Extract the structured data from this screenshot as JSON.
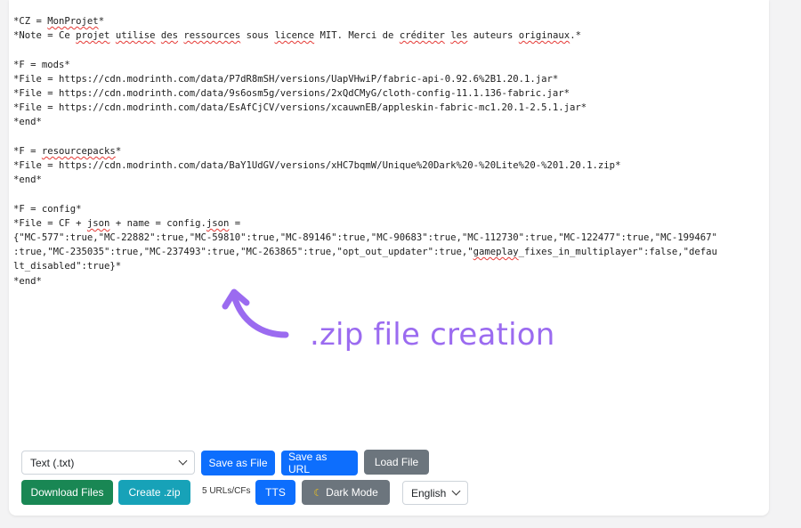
{
  "editor": {
    "lines": [
      [
        {
          "t": "*CZ = "
        },
        {
          "t": "MonProjet",
          "sq": true
        },
        {
          "t": "*"
        }
      ],
      [
        {
          "t": "*Note = Ce "
        },
        {
          "t": "projet",
          "sq": true
        },
        {
          "t": " "
        },
        {
          "t": "utilise",
          "sq": true
        },
        {
          "t": " "
        },
        {
          "t": "des",
          "sq": true
        },
        {
          "t": " "
        },
        {
          "t": "ressources",
          "sq": true
        },
        {
          "t": " sous "
        },
        {
          "t": "licence",
          "sq": true
        },
        {
          "t": " MIT. Merci de "
        },
        {
          "t": "créditer",
          "sq": true
        },
        {
          "t": " "
        },
        {
          "t": "les",
          "sq": true
        },
        {
          "t": " auteurs "
        },
        {
          "t": "originaux",
          "sq": true
        },
        {
          "t": ".*"
        }
      ],
      [],
      [
        {
          "t": "*F = mods*"
        }
      ],
      [
        {
          "t": "*File = https://cdn.modrinth.com/data/P7dR8mSH/versions/UapVHwiP/fabric-api-0.92.6%2B1.20.1.jar*"
        }
      ],
      [
        {
          "t": "*File = https://cdn.modrinth.com/data/9s6osm5g/versions/2xQdCMyG/cloth-config-11.1.136-fabric.jar*"
        }
      ],
      [
        {
          "t": "*File = https://cdn.modrinth.com/data/EsAfCjCV/versions/xcauwnEB/appleskin-fabric-mc1.20.1-2.5.1.jar*"
        }
      ],
      [
        {
          "t": "*end*"
        }
      ],
      [],
      [
        {
          "t": "*F = "
        },
        {
          "t": "resourcepacks",
          "sq": true
        },
        {
          "t": "*"
        }
      ],
      [
        {
          "t": "*File = https://cdn.modrinth.com/data/BaY1UdGV/versions/xHC7bqmW/Unique%20Dark%20-%20Lite%20-%201.20.1.zip*"
        }
      ],
      [
        {
          "t": "*end*"
        }
      ],
      [],
      [
        {
          "t": "*F = config*"
        }
      ],
      [
        {
          "t": "*File = CF + "
        },
        {
          "t": "json",
          "sq": true
        },
        {
          "t": " + name = config."
        },
        {
          "t": "json",
          "sq": true
        },
        {
          "t": " ="
        }
      ],
      [
        {
          "t": "{\"MC-577\":true,\"MC-22882\":true,\"MC-59810\":true,\"MC-89146\":true,\"MC-90683\":true,\"MC-112730\":true,\"MC-122477\":true,\"MC-199467\""
        }
      ],
      [
        {
          "t": ":true,\"MC-235035\":true,\"MC-237493\":true,\"MC-263865\":true,\"opt_out_updater\":true,\""
        },
        {
          "t": "gameplay",
          "sq": true
        },
        {
          "t": "_fixes_in_multiplayer\":false,\"defau"
        }
      ],
      [
        {
          "t": "lt_disabled\":true}*"
        }
      ],
      [
        {
          "t": "*end*"
        }
      ]
    ]
  },
  "annotation": {
    "text": ".zip file creation",
    "color": "#9b6bf0"
  },
  "controls": {
    "format_select": "Text (.txt)",
    "save_file": "Save as File",
    "save_url": "Save as URL",
    "load_file": "Load File",
    "download_files": "Download Files",
    "create_zip": "Create .zip",
    "count": "5 URLs/CFs",
    "tts": "TTS",
    "dark_mode": "Dark Mode",
    "dark_mode_icon": "moon-icon",
    "language_select": "English"
  },
  "colors": {
    "primary": "#0d6efd",
    "secondary": "#6c757d",
    "success": "#198754",
    "info": "#17a2b8"
  }
}
